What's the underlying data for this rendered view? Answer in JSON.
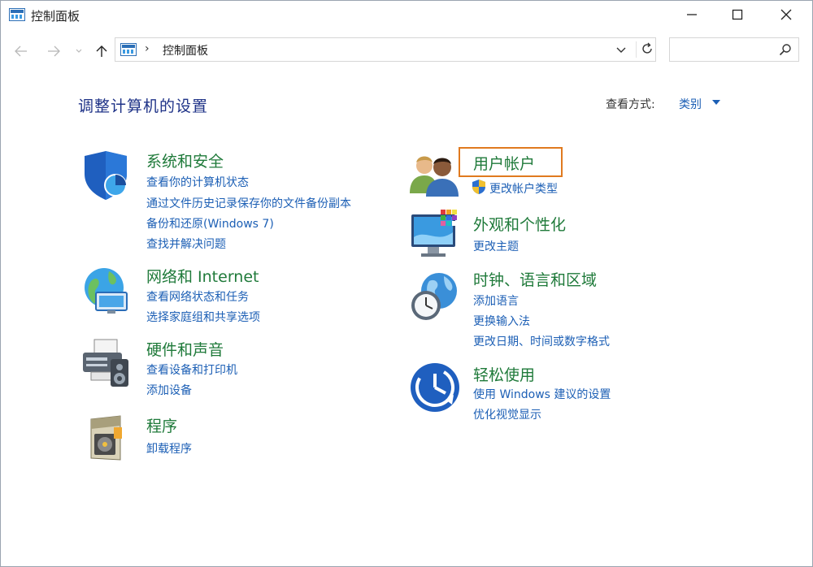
{
  "window": {
    "title": "控制面板"
  },
  "address": {
    "path": "控制面板",
    "separator": "›"
  },
  "search": {
    "placeholder": ""
  },
  "header": {
    "title": "调整计算机的设置",
    "view_by_label": "查看方式:",
    "view_by_value": "类别"
  },
  "categories": {
    "security": {
      "title": "系统和安全",
      "links": [
        "查看你的计算机状态",
        "通过文件历史记录保存你的文件备份副本",
        "备份和还原(Windows 7)",
        "查找并解决问题"
      ]
    },
    "network": {
      "title": "网络和 Internet",
      "links": [
        "查看网络状态和任务",
        "选择家庭组和共享选项"
      ]
    },
    "hardware": {
      "title": "硬件和声音",
      "links": [
        "查看设备和打印机",
        "添加设备"
      ]
    },
    "programs": {
      "title": "程序",
      "links": [
        "卸载程序"
      ]
    },
    "accounts": {
      "title": "用户帐户",
      "links": [
        "更改帐户类型"
      ]
    },
    "appearance": {
      "title": "外观和个性化",
      "links": [
        "更改主题"
      ]
    },
    "clock": {
      "title": "时钟、语言和区域",
      "links": [
        "添加语言",
        "更换输入法",
        "更改日期、时间或数字格式"
      ]
    },
    "ease": {
      "title": "轻松使用",
      "links": [
        "使用 Windows 建议的设置",
        "优化视觉显示"
      ]
    }
  },
  "colors": {
    "title_blue": "#1e3287",
    "category_green": "#1f7a3a",
    "link_blue": "#1c5fb5",
    "highlight_orange": "#e07a1f"
  }
}
